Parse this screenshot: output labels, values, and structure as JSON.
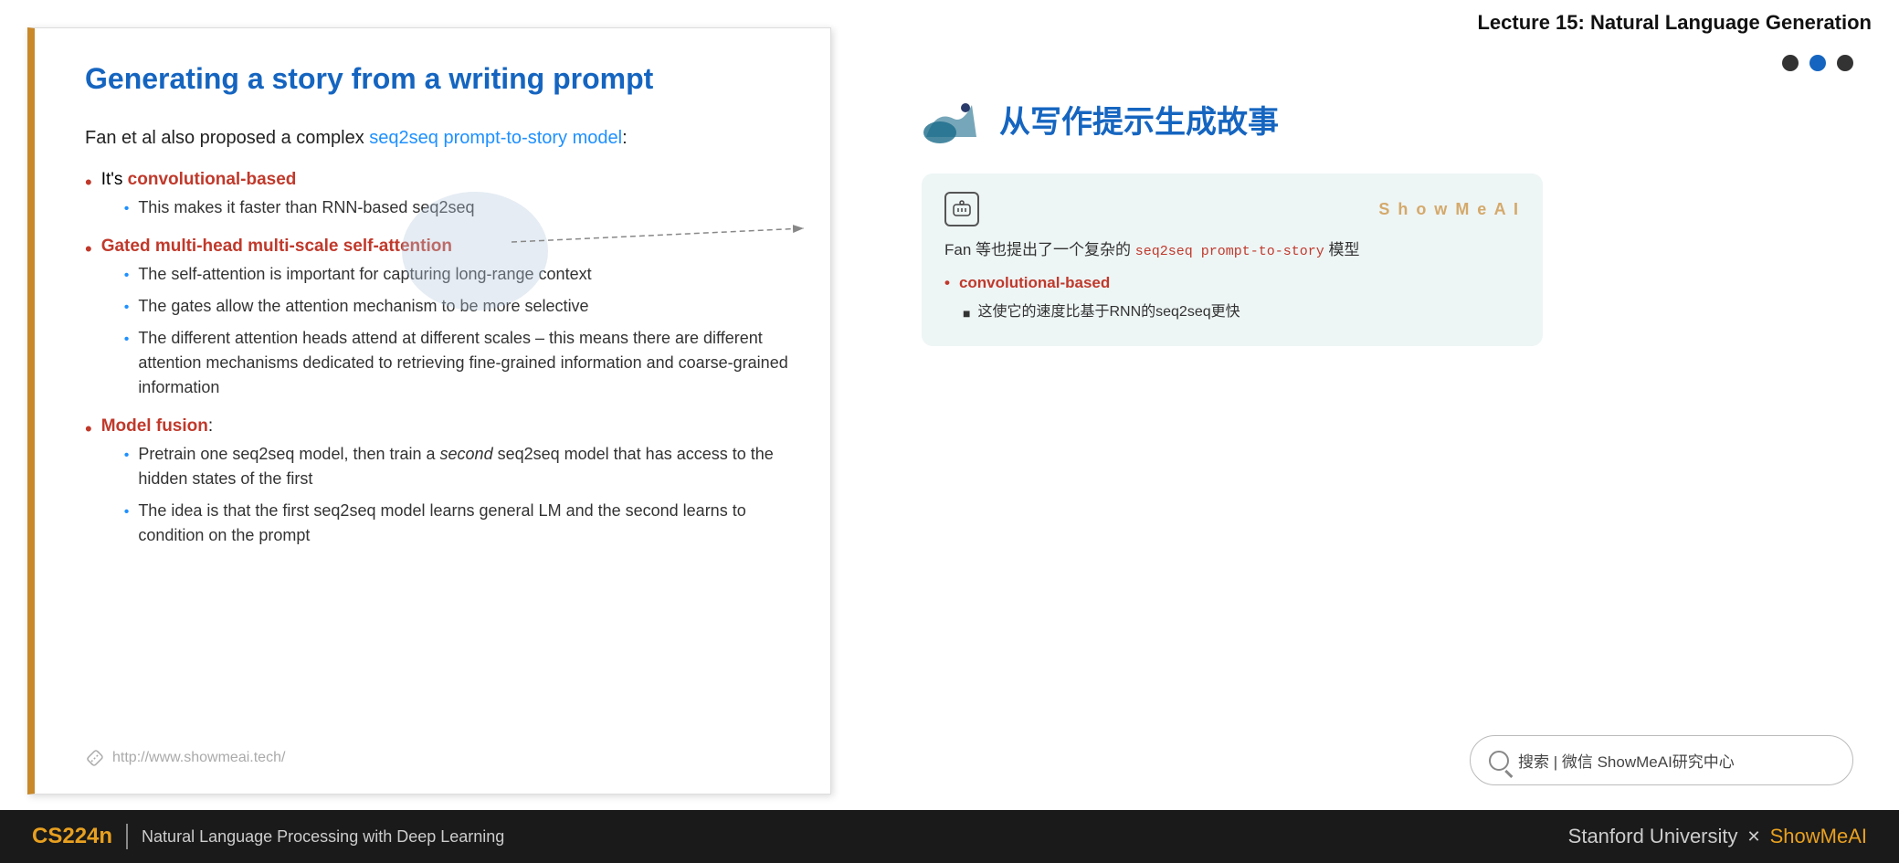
{
  "header": {
    "lecture_title": "Lecture 15: Natural Language Generation"
  },
  "slide": {
    "title": "Generating a story from a writing prompt",
    "intro_text": "Fan et al also proposed a complex ",
    "intro_link": "seq2seq prompt-to-story model",
    "intro_suffix": ":",
    "bullets": [
      {
        "type": "main-red",
        "text": "It's ",
        "highlight": "convolutional-based",
        "sub_bullets": [
          {
            "text": "This makes it faster than RNN-based seq2seq"
          }
        ]
      },
      {
        "type": "main-red",
        "text": "Gated multi-head multi-scale self-attention",
        "sub_bullets": [
          {
            "text": "The self-attention is important for capturing long-range context"
          },
          {
            "text": "The gates allow the attention mechanism to be more selective"
          },
          {
            "text": "The different attention heads attend at different scales – this means there are different attention mechanisms dedicated to retrieving fine-grained information and coarse-grained information"
          }
        ]
      },
      {
        "type": "main-red",
        "text": "Model fusion",
        "suffix": ":",
        "sub_bullets": [
          {
            "text": "Pretrain one seq2seq model, then train a second seq2seq model that has access to the hidden states of the first",
            "italic_word": "second"
          },
          {
            "text": "The idea is that the first seq2seq model learns general LM and the second learns to condition on the prompt"
          }
        ]
      }
    ],
    "url": "http://www.showmeai.tech/"
  },
  "right_panel": {
    "nav_dots": [
      "dark",
      "blue",
      "dark"
    ],
    "chinese_title": "从写作提示生成故事",
    "card": {
      "brand": "S h o w M e A I",
      "body_text": "Fan 等也提出了一个复杂的 ",
      "body_link": "seq2seq prompt-to-story",
      "body_suffix": " 模型",
      "bullet_main": "convolutional-based",
      "sub_bullet": "这使它的速度比基于RNN的seq2seq更快"
    },
    "search": {
      "text": "搜索 | 微信 ShowMeAI研究中心"
    }
  },
  "footer": {
    "course_code": "CS224n",
    "divider": "|",
    "course_name": "Natural Language Processing with Deep Learning",
    "right_text": "Stanford University",
    "x": "✕",
    "showmeai": "ShowMeAI"
  }
}
